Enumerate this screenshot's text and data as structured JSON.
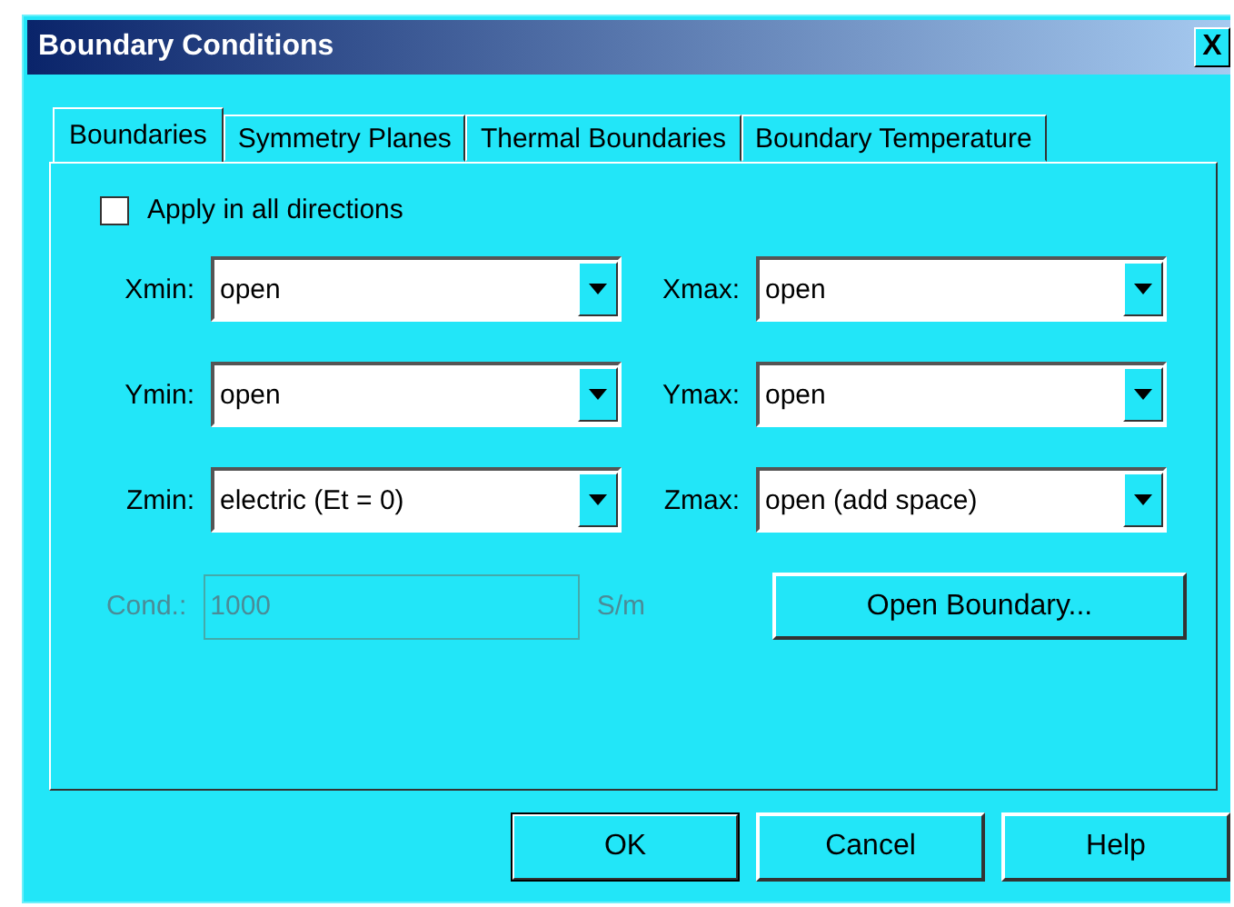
{
  "window": {
    "title": "Boundary Conditions",
    "close": "X"
  },
  "tabs": [
    {
      "label": "Boundaries",
      "selected": true
    },
    {
      "label": "Symmetry Planes",
      "selected": false
    },
    {
      "label": "Thermal Boundaries",
      "selected": false
    },
    {
      "label": "Boundary Temperature",
      "selected": false
    }
  ],
  "apply_all": {
    "label": "Apply in all directions",
    "checked": false
  },
  "combos": [
    {
      "label": "Xmin:",
      "value": "open"
    },
    {
      "label": "Xmax:",
      "value": "open"
    },
    {
      "label": "Ymin:",
      "value": "open"
    },
    {
      "label": "Ymax:",
      "value": "open"
    },
    {
      "label": "Zmin:",
      "value": "electric (Et = 0)"
    },
    {
      "label": "Zmax:",
      "value": "open (add space)"
    }
  ],
  "conductivity": {
    "label": "Cond.:",
    "value": "1000",
    "unit": "S/m",
    "disabled": true
  },
  "open_boundary_button": "Open Boundary...",
  "buttons": [
    {
      "label": "OK",
      "default": true
    },
    {
      "label": "Cancel",
      "default": false
    },
    {
      "label": "Help",
      "default": false
    }
  ]
}
